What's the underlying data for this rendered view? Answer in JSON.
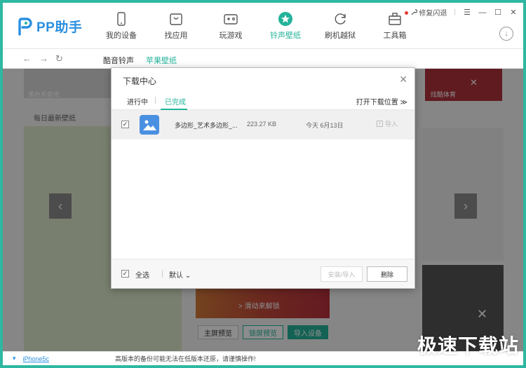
{
  "app": {
    "name": "PP助手",
    "brand_color": "#2a8fe0",
    "accent_color": "#24b39a"
  },
  "nav": {
    "items": [
      {
        "label": "我的设备",
        "icon": "phone-icon"
      },
      {
        "label": "找应用",
        "icon": "app-bag-icon"
      },
      {
        "label": "玩游戏",
        "icon": "gamepad-icon"
      },
      {
        "label": "铃声壁纸",
        "icon": "star-circle-icon"
      },
      {
        "label": "刷机越狱",
        "icon": "refresh-icon"
      },
      {
        "label": "工具箱",
        "icon": "toolbox-icon"
      }
    ],
    "active_index": 3
  },
  "window": {
    "fix_label": "修复闪退",
    "menu_glyph": "☰",
    "minimize_glyph": "—",
    "maximize_glyph": "☐",
    "close_glyph": "✕",
    "download_glyph": "↓"
  },
  "subbar": {
    "back_glyph": "←",
    "forward_glyph": "→",
    "refresh_glyph": "↻",
    "tabs": [
      "酷音铃声",
      "苹果壁纸"
    ]
  },
  "background": {
    "banner_left": "黑色系壁纸",
    "banner_right": "炫酷体育",
    "section_title": "每日最新壁纸",
    "slide_hint": "> 滑动来解锁",
    "prev_glyph": "‹",
    "next_glyph": "›",
    "preview_buttons": [
      "主屏预览",
      "锁屏预览",
      "导入设备"
    ],
    "lightbox_close": "✕"
  },
  "dialog": {
    "title": "下载中心",
    "close_glyph": "✕",
    "tab_in_progress": "进行中",
    "tab_completed": "已完成",
    "open_folder": "打开下载位置",
    "open_folder_glyph": "≫",
    "rows": [
      {
        "checked": "✓",
        "name": "多边形_艺术多边形_...",
        "size": "223.27 KB",
        "date": "今天 6月13日",
        "action": "导入"
      }
    ],
    "footer": {
      "select_all_check": "✓",
      "select_all": "全选",
      "sort": "默认",
      "sort_glyph": "⌄",
      "install_import": "安装/导入",
      "delete": "删除"
    }
  },
  "status": {
    "device_glyph": "▾",
    "device": "iPhone5c",
    "message": "高版本的备份可能无法在低版本还原，请谨慎操作!"
  },
  "watermark": "极速下载站"
}
